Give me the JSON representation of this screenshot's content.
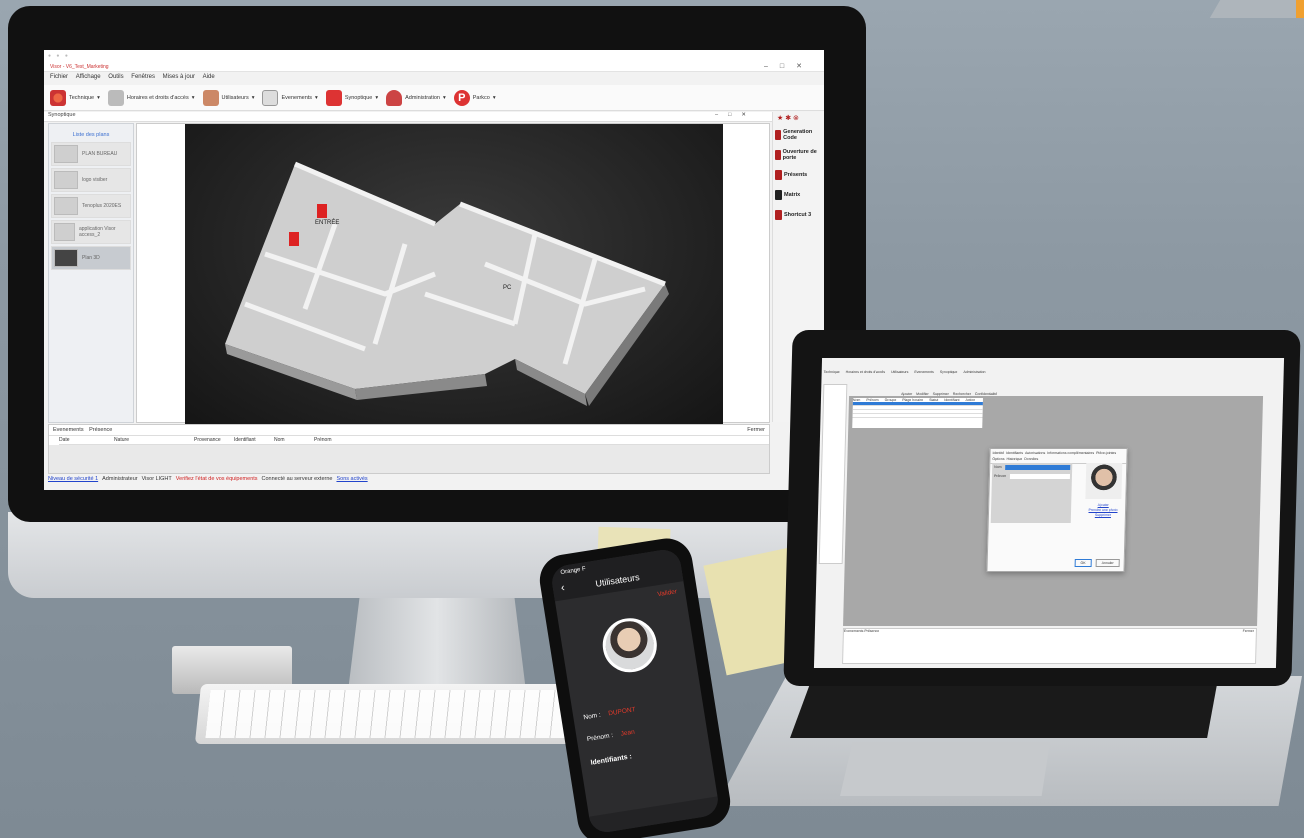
{
  "monitor": {
    "window_title": "Visor - V6_Test_Marketing",
    "menu": [
      "Fichier",
      "Affichage",
      "Outils",
      "Fenêtres",
      "Mises à jour",
      "Aide"
    ],
    "toolbar": [
      "Technique",
      "Horaires et droits d'accès",
      "Utilisateurs",
      "Evenements",
      "Synoptique",
      "Administration",
      "Parkco"
    ],
    "panel_title": "Synoptique",
    "plans_title": "Liste des plans",
    "plans": [
      "PLAN BUREAU",
      "logo visiber",
      "Tenoplus 2020ES",
      "application Visor access_2",
      "Plan 3D"
    ],
    "scene_labels": [
      "ENTRÉE",
      "PC"
    ],
    "right_panel": [
      "Generation Code",
      "Ouverture de porte",
      "Présents",
      "Matrix",
      "Shortcut 3"
    ],
    "events_tabs": [
      "Evenements",
      "Présence"
    ],
    "events_close": "Fermer",
    "events_columns": [
      "Date",
      "Nature",
      "Provenance",
      "Identifiant",
      "Nom",
      "Prénom"
    ],
    "status": {
      "level": "Niveau de sécurité 1",
      "user": "Administrateur",
      "product": "Visor LIGHT",
      "warning": "Verifiez l'état de vos équipements",
      "server": "Connecté au serveur externe",
      "services": "Sons activés"
    }
  },
  "laptop": {
    "toolbar": [
      "Technique",
      "Horaires et droits d'accès",
      "Utilisateurs",
      "Evenements",
      "Synoptique",
      "Administration"
    ],
    "actions": [
      "Ajouter",
      "Modifier",
      "Supprimer",
      "Rechercher",
      "Confidentialité"
    ],
    "table_headers": [
      "Nom",
      "Prénom",
      "Groupe",
      "Plage horaire",
      "Statut",
      "Identifiant",
      "Action"
    ],
    "dialog_tabs": [
      "Identité",
      "Identifiants",
      "Autorisations",
      "Informations complémentaires",
      "Pièce-jointes",
      "Options",
      "Historique",
      "Données"
    ],
    "dialog_fields": [
      "Nom",
      "Prénom"
    ],
    "dialog_links": [
      "Ajouter",
      "Prendre une photo",
      "Supprimer"
    ],
    "dialog_buttons": [
      "OK",
      "Annuler"
    ],
    "events_tabs": [
      "Evenements",
      "Présence"
    ],
    "events_close": "Fermer"
  },
  "phone": {
    "time": "Orange F",
    "title": "Utilisateurs",
    "valider": "Valider",
    "nom_label": "Nom :",
    "nom_value": "DUPONT",
    "prenom_label": "Prénom :",
    "prenom_value": "Jean",
    "identifiants": "Identifiants :"
  },
  "colors": {
    "accent_red": "#e23a2a",
    "link_blue": "#2244cc",
    "selection_blue": "#2f7bd6"
  }
}
